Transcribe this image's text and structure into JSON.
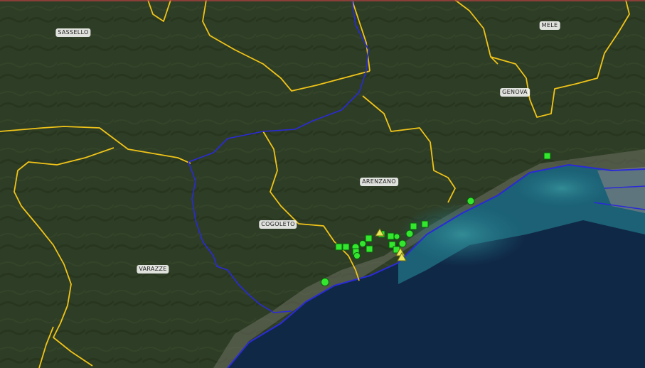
{
  "map": {
    "place_labels": [
      "SASSELLO",
      "MELE",
      "GENOVA",
      "ARENZANO",
      "COGOLETO",
      "VARAZZE"
    ],
    "colors": {
      "land": "#2f3f26",
      "sea_deep": "#0f2846",
      "sea_shallow": "#1f6f82",
      "municipal_boundary": "#f0c419",
      "regional_boundary": "#2a2ad8",
      "marker_fill": "#33e62e",
      "marker_stroke": "#0b5d0b",
      "triangle_fill": "#e8e85a"
    },
    "marker_types": {
      "square": "square-marker",
      "circle": "circle-marker",
      "triangle": "triangle-marker"
    }
  }
}
